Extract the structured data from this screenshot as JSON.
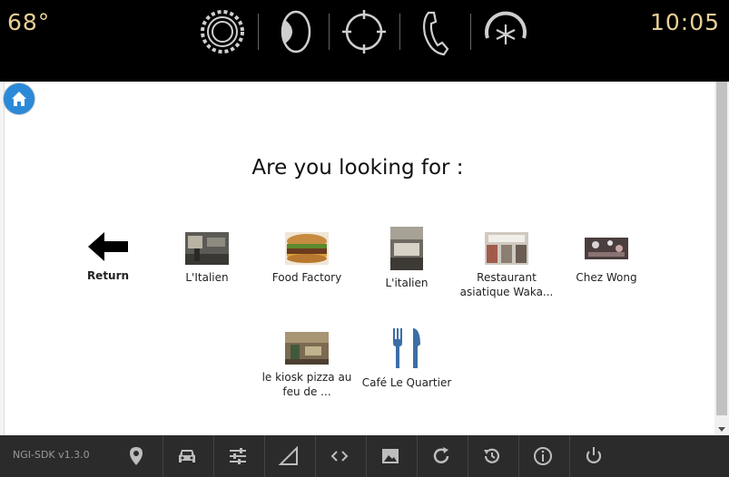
{
  "topbar": {
    "temperature": "68°",
    "time": "10:05",
    "icons": [
      "settings-gear-icon",
      "audio-speaker-icon",
      "navigation-target-icon",
      "phone-icon",
      "climate-fan-icon"
    ]
  },
  "main": {
    "heading": "Are you looking for :",
    "return_label": "Return",
    "items": [
      {
        "label": "L'Italien"
      },
      {
        "label": "Food Factory"
      },
      {
        "label": "L'italien"
      },
      {
        "label": "Restaurant asiatique Waka..."
      },
      {
        "label": "Chez Wong"
      },
      {
        "label": "le kiosk pizza au feu de ..."
      },
      {
        "label": "Café Le Quartier"
      }
    ]
  },
  "bottombar": {
    "sdk_version": "NGI-SDK v1.3.0",
    "icons": [
      "location-pin-icon",
      "car-icon",
      "sliders-icon",
      "signal-icon",
      "code-icon",
      "image-icon",
      "refresh-icon",
      "history-icon",
      "info-icon",
      "power-icon"
    ]
  },
  "colors": {
    "accent": "#e8cf96",
    "home_button": "#2b8ad8",
    "bottom_bar": "#2b2b2b"
  }
}
